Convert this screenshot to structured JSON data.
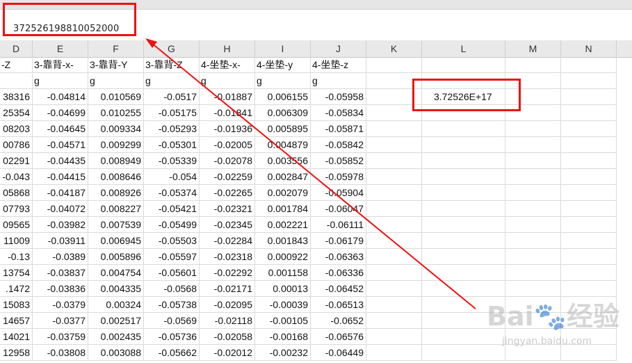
{
  "formula_bar": {
    "value": "372526198810052000"
  },
  "columns": [
    "D",
    "E",
    "F",
    "G",
    "H",
    "I",
    "J",
    "K",
    "L",
    "M",
    "N"
  ],
  "header_row": [
    "-Z",
    "3-靠背-x-",
    "3-靠背-Y",
    "3-靠背-Z",
    "4-坐垫-x-",
    "4-坐垫-y",
    "4-坐垫-z"
  ],
  "unit_row": [
    "",
    "g",
    "g",
    "g",
    "g",
    "g",
    "g"
  ],
  "rows": [
    [
      "38316",
      "-0.04814",
      "0.010569",
      "-0.0517",
      "-0.01887",
      "0.006155",
      "-0.05958"
    ],
    [
      "25354",
      "-0.04699",
      "0.010255",
      "-0.05175",
      "-0.01841",
      "0.006309",
      "-0.05834"
    ],
    [
      "08203",
      "-0.04645",
      "0.009334",
      "-0.05293",
      "-0.01936",
      "0.005895",
      "-0.05871"
    ],
    [
      "00786",
      "-0.04571",
      "0.009299",
      "-0.05301",
      "-0.02005",
      "0.004879",
      "-0.05842"
    ],
    [
      "02291",
      "-0.04435",
      "0.008949",
      "-0.05339",
      "-0.02078",
      "0.003556",
      "-0.05852"
    ],
    [
      "-0.043",
      "-0.04415",
      "0.008646",
      "-0.054",
      "-0.02259",
      "0.002847",
      "-0.05978"
    ],
    [
      "05868",
      "-0.04187",
      "0.008926",
      "-0.05374",
      "-0.02265",
      "0.002079",
      "-0.05904"
    ],
    [
      "07793",
      "-0.04072",
      "0.008227",
      "-0.05421",
      "-0.02321",
      "0.001784",
      "-0.06047"
    ],
    [
      "09565",
      "-0.03982",
      "0.007539",
      "-0.05499",
      "-0.02345",
      "0.002221",
      "-0.06111"
    ],
    [
      "11009",
      "-0.03911",
      "0.006945",
      "-0.05503",
      "-0.02284",
      "0.001843",
      "-0.06179"
    ],
    [
      "-0.13",
      "-0.0389",
      "0.005896",
      "-0.05597",
      "-0.02318",
      "0.000922",
      "-0.06363"
    ],
    [
      "13754",
      "-0.03837",
      "0.004754",
      "-0.05601",
      "-0.02292",
      "0.001158",
      "-0.06336"
    ],
    [
      ".1472",
      "-0.03836",
      "0.004335",
      "-0.0568",
      "-0.02171",
      "0.00013",
      "-0.06452"
    ],
    [
      "15083",
      "-0.0379",
      "0.00324",
      "-0.05738",
      "-0.02095",
      "-0.00039",
      "-0.06513"
    ],
    [
      "14657",
      "-0.0377",
      "0.002517",
      "-0.0569",
      "-0.02118",
      "-0.00105",
      "-0.0652"
    ],
    [
      "14021",
      "-0.03759",
      "0.002435",
      "-0.05736",
      "-0.02058",
      "-0.00168",
      "-0.06576"
    ],
    [
      "12958",
      "-0.03808",
      "0.003088",
      "-0.05662",
      "-0.02012",
      "-0.00232",
      "-0.06449"
    ]
  ],
  "highlight_cell_value": "3.72526E+17",
  "annotation_color": "#ee1111",
  "watermark": {
    "main": "Bai🐾经验",
    "sub": "jingyan.baidu.com"
  }
}
